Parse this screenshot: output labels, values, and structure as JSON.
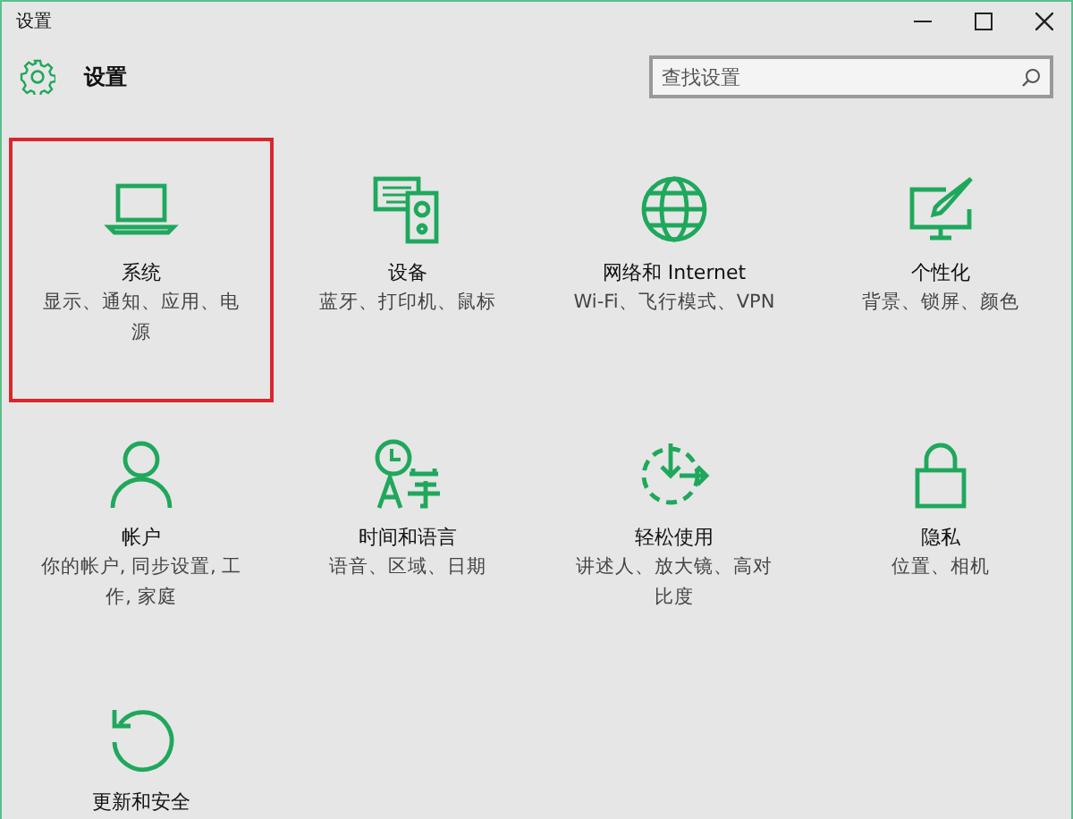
{
  "window": {
    "title": "设置"
  },
  "header": {
    "title": "设置"
  },
  "search": {
    "placeholder": "查找设置"
  },
  "tiles": [
    {
      "kind": "laptop",
      "title": "系统",
      "description": "显示、通知、应用、电源",
      "highlighted": true
    },
    {
      "kind": "devices",
      "title": "设备",
      "description": "蓝牙、打印机、鼠标",
      "highlighted": false
    },
    {
      "kind": "globe",
      "title": "网络和 Internet",
      "description": "Wi-Fi、飞行模式、VPN",
      "highlighted": false
    },
    {
      "kind": "paint",
      "title": "个性化",
      "description": "背景、锁屏、颜色",
      "highlighted": false
    },
    {
      "kind": "person",
      "title": "帐户",
      "description": "你的帐户, 同步设置, 工作, 家庭",
      "highlighted": false
    },
    {
      "kind": "time",
      "title": "时间和语言",
      "description": "语音、区域、日期",
      "highlighted": false
    },
    {
      "kind": "ease",
      "title": "轻松使用",
      "description": "讲述人、放大镜、高对比度",
      "highlighted": false
    },
    {
      "kind": "lock",
      "title": "隐私",
      "description": "位置、相机",
      "highlighted": false
    },
    {
      "kind": "update",
      "title": "更新和安全",
      "highlighted": false
    }
  ]
}
